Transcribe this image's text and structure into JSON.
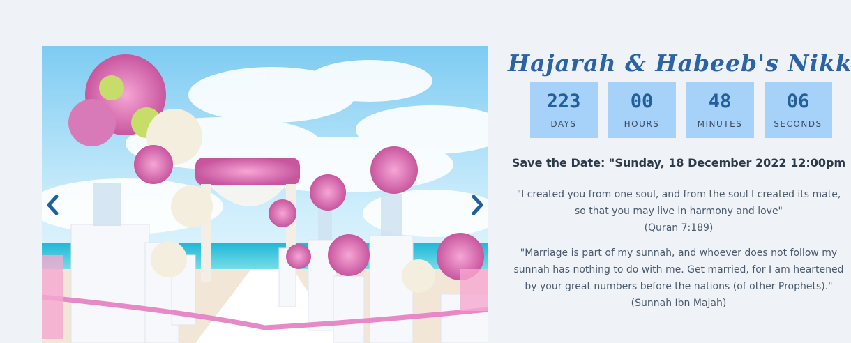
{
  "carousel": {
    "prev_icon": "chevron-left-icon",
    "next_icon": "chevron-right-icon",
    "arrow_color": "#1f5f9f"
  },
  "event": {
    "title": "Hajarah & Habeeb's Nikkah",
    "save_the_date": "Save the Date: \"Sunday, 18 December 2022 12:00pm"
  },
  "countdown": [
    {
      "value": "223",
      "label": "DAYS"
    },
    {
      "value": "00",
      "label": "HOURS"
    },
    {
      "value": "48",
      "label": "MINUTES"
    },
    {
      "value": "06",
      "label": "SECONDS"
    }
  ],
  "quotes": [
    {
      "line1": "\"I created you from one soul, and from the soul I created its mate,",
      "line2": "so that you may live in harmony and love\"",
      "source": "(Quran 7:189)"
    },
    {
      "line1": "\"Marriage is part of my sunnah, and whoever does not follow my",
      "line2": "sunnah has nothing to do with me. Get married, for I am heartened",
      "line3": "by your great numbers before the nations (of other Prophets).\"",
      "source": "(Sunnah Ibn Majah)"
    }
  ],
  "colors": {
    "background": "#eff2f6",
    "title": "#2a64a6",
    "countdown_box": "#a6d2fa",
    "countdown_value": "#235f9a"
  }
}
